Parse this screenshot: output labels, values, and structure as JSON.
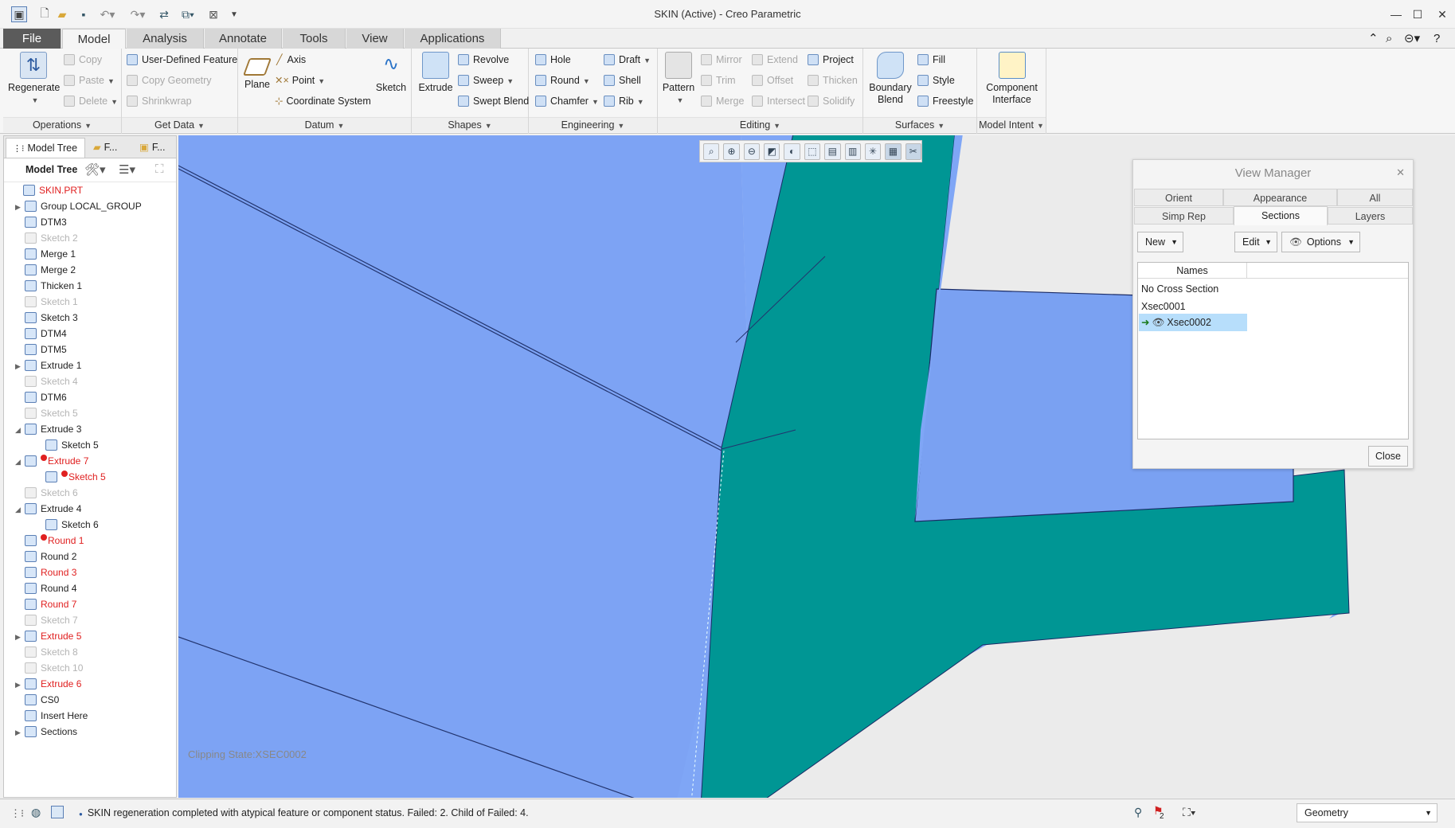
{
  "window": {
    "title": "SKIN (Active) - Creo Parametric"
  },
  "tabs": [
    {
      "label": "File"
    },
    {
      "label": "Model"
    },
    {
      "label": "Analysis"
    },
    {
      "label": "Annotate"
    },
    {
      "label": "Tools"
    },
    {
      "label": "View"
    },
    {
      "label": "Applications"
    }
  ],
  "ribbon": {
    "operations": {
      "label": "Operations",
      "regenerate": "Regenerate",
      "copy": "Copy",
      "paste": "Paste",
      "delete": "Delete"
    },
    "get_data": {
      "label": "Get Data",
      "udf": "User-Defined Feature",
      "copy_geometry": "Copy Geometry",
      "shrinkwrap": "Shrinkwrap"
    },
    "datum": {
      "label": "Datum",
      "plane": "Plane",
      "axis": "Axis",
      "point": "Point",
      "coordinate_system": "Coordinate System",
      "sketch": "Sketch"
    },
    "shapes": {
      "label": "Shapes",
      "extrude": "Extrude",
      "revolve": "Revolve",
      "sweep": "Sweep",
      "swept_blend": "Swept Blend"
    },
    "engineering": {
      "label": "Engineering",
      "hole": "Hole",
      "round": "Round",
      "chamfer": "Chamfer",
      "draft": "Draft",
      "shell": "Shell",
      "rib": "Rib"
    },
    "editing": {
      "label": "Editing",
      "pattern": "Pattern",
      "mirror": "Mirror",
      "trim": "Trim",
      "merge": "Merge",
      "extend": "Extend",
      "offset": "Offset",
      "intersect": "Intersect",
      "project": "Project",
      "thicken": "Thicken",
      "solidify": "Solidify"
    },
    "surfaces": {
      "label": "Surfaces",
      "boundary_blend_1": "Boundary",
      "boundary_blend_2": "Blend",
      "fill": "Fill",
      "style": "Style",
      "freestyle": "Freestyle"
    },
    "model_intent": {
      "label": "Model Intent",
      "component_interface_1": "Component",
      "component_interface_2": "Interface"
    }
  },
  "left_panel": {
    "tabs": [
      "Model Tree",
      "F...",
      "F..."
    ],
    "toolbar_label": "Model Tree",
    "tree": [
      {
        "label": "SKIN.PRT",
        "state": "red",
        "expand": ""
      },
      {
        "label": "Group LOCAL_GROUP",
        "state": "normal",
        "expand": "▶"
      },
      {
        "label": "DTM3",
        "state": "normal",
        "expand": ""
      },
      {
        "label": "Sketch 2",
        "state": "gray",
        "expand": ""
      },
      {
        "label": "Merge 1",
        "state": "normal",
        "expand": ""
      },
      {
        "label": "Merge 2",
        "state": "normal",
        "expand": ""
      },
      {
        "label": "Thicken 1",
        "state": "normal",
        "expand": ""
      },
      {
        "label": "Sketch 1",
        "state": "gray",
        "expand": ""
      },
      {
        "label": "Sketch 3",
        "state": "normal",
        "expand": ""
      },
      {
        "label": "DTM4",
        "state": "normal",
        "expand": ""
      },
      {
        "label": "DTM5",
        "state": "normal",
        "expand": ""
      },
      {
        "label": "Extrude 1",
        "state": "normal",
        "expand": "▶"
      },
      {
        "label": "Sketch 4",
        "state": "gray",
        "expand": ""
      },
      {
        "label": "DTM6",
        "state": "normal",
        "expand": ""
      },
      {
        "label": "Sketch 5",
        "state": "gray",
        "expand": ""
      },
      {
        "label": "Extrude 3",
        "state": "normal",
        "expand": "◢"
      },
      {
        "label": "Sketch 5",
        "state": "normal",
        "expand": "",
        "indent": true
      },
      {
        "label": "Extrude 7",
        "state": "red",
        "expand": "◢",
        "error": true
      },
      {
        "label": "Sketch 5",
        "state": "red",
        "expand": "",
        "indent": true,
        "error": true
      },
      {
        "label": "Sketch 6",
        "state": "gray",
        "expand": ""
      },
      {
        "label": "Extrude 4",
        "state": "normal",
        "expand": "◢"
      },
      {
        "label": "Sketch 6",
        "state": "normal",
        "expand": "",
        "indent": true
      },
      {
        "label": "Round 1",
        "state": "red",
        "expand": "",
        "error": true
      },
      {
        "label": "Round 2",
        "state": "normal",
        "expand": ""
      },
      {
        "label": "Round 3",
        "state": "red",
        "expand": ""
      },
      {
        "label": "Round 4",
        "state": "normal",
        "expand": ""
      },
      {
        "label": "Round 7",
        "state": "red",
        "expand": ""
      },
      {
        "label": "Sketch 7",
        "state": "gray",
        "expand": ""
      },
      {
        "label": "Extrude 5",
        "state": "red",
        "expand": "▶"
      },
      {
        "label": "Sketch 8",
        "state": "gray",
        "expand": ""
      },
      {
        "label": "Sketch 10",
        "state": "gray",
        "expand": ""
      },
      {
        "label": "Extrude 6",
        "state": "red",
        "expand": "▶"
      },
      {
        "label": "CS0",
        "state": "normal",
        "expand": ""
      },
      {
        "label": "Insert Here",
        "state": "normal",
        "expand": ""
      },
      {
        "label": "Sections",
        "state": "normal",
        "expand": "▶"
      }
    ]
  },
  "viewport": {
    "clipping_state": "Clipping State:XSEC0002"
  },
  "view_manager": {
    "title": "View Manager",
    "tabs_row1": [
      "Orient",
      "Appearance",
      "All"
    ],
    "tabs_row2": [
      "Simp Rep",
      "Sections",
      "Layers"
    ],
    "new_label": "New",
    "edit_label": "Edit",
    "options_label": "Options",
    "names_header": "Names",
    "items": [
      "No Cross Section",
      "Xsec0001",
      "Xsec0002"
    ],
    "close_label": "Close"
  },
  "status": {
    "message": "SKIN regeneration completed with atypical feature or component status. Failed: 2. Child of Failed: 4.",
    "flag_count": "2",
    "filter": "Geometry"
  },
  "colors": {
    "blue_surface": "#7ea5f5",
    "teal_surface": "#009694",
    "selection": "#b7defb",
    "error": "#e02020"
  }
}
